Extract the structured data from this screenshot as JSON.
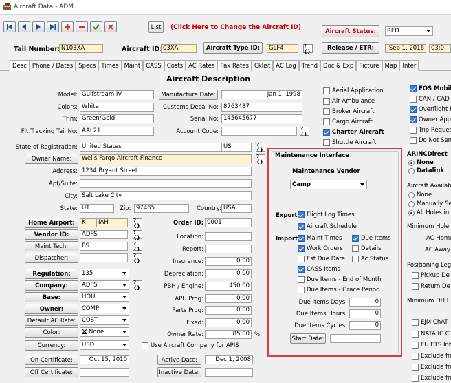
{
  "window": {
    "title": "Aircraft Data - ADM"
  },
  "toolbar": {
    "nav_icons": [
      "first-record-icon",
      "previous-record-icon",
      "next-record-icon",
      "last-record-icon",
      "add-record-icon",
      "delete-record-icon",
      "save-check-icon",
      "cancel-x-icon"
    ],
    "list_label": "List",
    "change_link": "(Click Here to Change the Aircraft ID)",
    "status_label": "Aircraft Status:",
    "status_value": "RED",
    "release_label": "Release / ETR:",
    "release_date": "Sep 1, 2016",
    "release_time": "03:0"
  },
  "header": {
    "tail_label": "Tail Number:",
    "tail_value": "N103XA",
    "aircraft_id_label": "Aircraft ID:",
    "aircraft_id_value": "03XA",
    "type_label": "Aircraft Type ID:",
    "type_value": "GLF4"
  },
  "tabs": [
    "Desc",
    "Phone / Dates",
    "Specs",
    "Times",
    "Maint",
    "CASS",
    "Costs",
    "AC Rates",
    "Pax Rates",
    "Cklist",
    "AC Log",
    "Trend",
    "Doc & Exp",
    "Picture",
    "Map",
    "Inter"
  ],
  "desc": {
    "section_title": "Aircraft Description",
    "model_label": "Model:",
    "model_value": "Gulfstream IV",
    "manufacture_label": "Manufacture Date:",
    "manufacture_value": "Jan 1, 1998",
    "colors_label": "Colors:",
    "colors_value": "White",
    "customs_label": "Customs Decal No:",
    "customs_value": "8763487",
    "trim_label": "Trim:",
    "trim_value": "Green/Gold",
    "serial_label": "Serial No:",
    "serial_value": "145645677",
    "flt_label": "Flt Tracking Tail No:",
    "flt_value": "AAL21",
    "account_label": "Account Code:",
    "account_value": "",
    "state_reg_label": "State of Registration:",
    "state_reg_value": "United States",
    "state_reg_code": "US",
    "owner_name_label": "Owner Name:",
    "owner_name_value": "Wells Fargo Aircraft Finance",
    "address_label": "Address:",
    "address_value": "1234 Bryant Street",
    "apt_label": "Apt/Suite:",
    "apt_value": "",
    "city_label": "City:",
    "city_value": "Salt Lake City",
    "state_label": "State:",
    "state_value": "UT",
    "zip_label": "Zip:",
    "zip_value": "97465",
    "country_label": "Country:",
    "country_value": "USA"
  },
  "left": {
    "home_airport_label": "Home Airport:",
    "home_airport_code": "K",
    "home_airport_value": "IAH",
    "vendor_label": "Vendor ID:",
    "vendor_value": "ADFS",
    "maint_tech_label": "Maint Tech:",
    "maint_tech_value": "BS",
    "dispatcher_label": "Dispatcher:",
    "dispatcher_value": "",
    "regulation_label": "Regulation:",
    "regulation_value": "135",
    "company_label": "Company:",
    "company_value": "ADFS",
    "base_label": "Base:",
    "base_value": "HOU",
    "owner_label": "Owner:",
    "owner_value": "COMP",
    "default_rate_label": "Default AC Rate:",
    "default_rate_value": "COST",
    "color_label": "Color:",
    "color_value": "None",
    "currency_label": "Currency:",
    "currency_value": "USD",
    "on_cert_label": "On Certificate:",
    "on_cert_value": "Oct 15, 2010",
    "off_cert_label": "Off Certificate:",
    "off_cert_value": ""
  },
  "middle": {
    "order_id_label": "Order ID:",
    "order_id_value": "0001",
    "location_label": "Location:",
    "location_value": "",
    "report_label": "Report:",
    "report_value": "",
    "insurance_label": "Insurance:",
    "insurance_value": "0.00",
    "depreciation_label": "Depreciation:",
    "depreciation_value": "0.00",
    "pbh_label": "PBH / Engine:",
    "pbh_value": "450.00",
    "apu_label": "APU Prog:",
    "apu_value": "0.00",
    "parts_label": "Parts Prog:",
    "parts_value": "0.00",
    "fixed_label": "Fixed:",
    "fixed_value": "0.00",
    "owner_rate_label": "Owner Rate:",
    "owner_rate_value": "85.00",
    "owner_rate_unit": "%",
    "apis_label": "Use Aircraft Company for APIS",
    "active_label": "Active Date:",
    "active_value": "Dec 1, 2008",
    "inactive_label": "Inactive Date:",
    "inactive_value": ""
  },
  "categories": {
    "items": [
      {
        "label": "Aerial Application",
        "checked": false
      },
      {
        "label": "Air Ambulance",
        "checked": false
      },
      {
        "label": "Broker Aircraft",
        "checked": false
      },
      {
        "label": "Cargo Aircraft",
        "checked": false
      },
      {
        "label": "Charter Aircraft",
        "checked": true
      },
      {
        "label": "Shuttle Aircraft",
        "checked": false
      }
    ]
  },
  "maint": {
    "title": "Maintenance Interface",
    "vendor_label": "Maintenance Vendor",
    "vendor_value": "Camp",
    "export_label": "Export:",
    "flight_log": "Flight Log Times",
    "aircraft_schedule": "Aircraft Schedule",
    "import_label": "Import:",
    "maint_times": "Maint Times",
    "due_items": "Due Items",
    "work_orders": "Work Orders",
    "details": "Details",
    "est_due": "Est Due Date",
    "ac_status": "Ac Status",
    "cass_items": "CASS Items",
    "due_end_month": "Due Items - End of Month",
    "due_grace": "Due Items - Grace Period",
    "due_days_label": "Due Items Days:",
    "due_days_value": "0",
    "due_hours_label": "Due Items Hours:",
    "due_hours_value": "0",
    "due_cycles_label": "Due Items Cycles:",
    "due_cycles_value": "0",
    "start_date_label": "Start Date:",
    "start_date_value": ""
  },
  "right": {
    "fos_mobile": "FOS Mobile",
    "can_cad": "CAN / CAD",
    "overflight": "Overflight P",
    "owner_app": "Owner App",
    "trip_request": "Trip Reques",
    "do_not_send": "Do Not Sen",
    "arinc_title": "ARINCDirect",
    "arinc_none": "None",
    "arinc_datalink": "Datalink",
    "aircraft_avail": "Aircraft Availab",
    "avail_none": "None",
    "avail_manual": "Manually Se",
    "avail_all": "All Holes in",
    "min_hole": "Minimum Hole",
    "ac_home": "AC Home",
    "ac_away": "AC Away",
    "positioning": "Positioning Leg",
    "pickup": "Pickup De",
    "return": "Return De",
    "min_dh": "Minimum DH L",
    "ejm": "EJM ChAT",
    "nata": "NATA IC C",
    "eu_ets": "EU ETS Int",
    "exclude1": "Exclude fro",
    "exclude2": "Exclude fro",
    "exclude3": "Exclude fro"
  },
  "colors": {
    "accent_red": "#cc0000",
    "field_yellow": "#fff3c9",
    "highlight_red_border": "#e0393d"
  }
}
